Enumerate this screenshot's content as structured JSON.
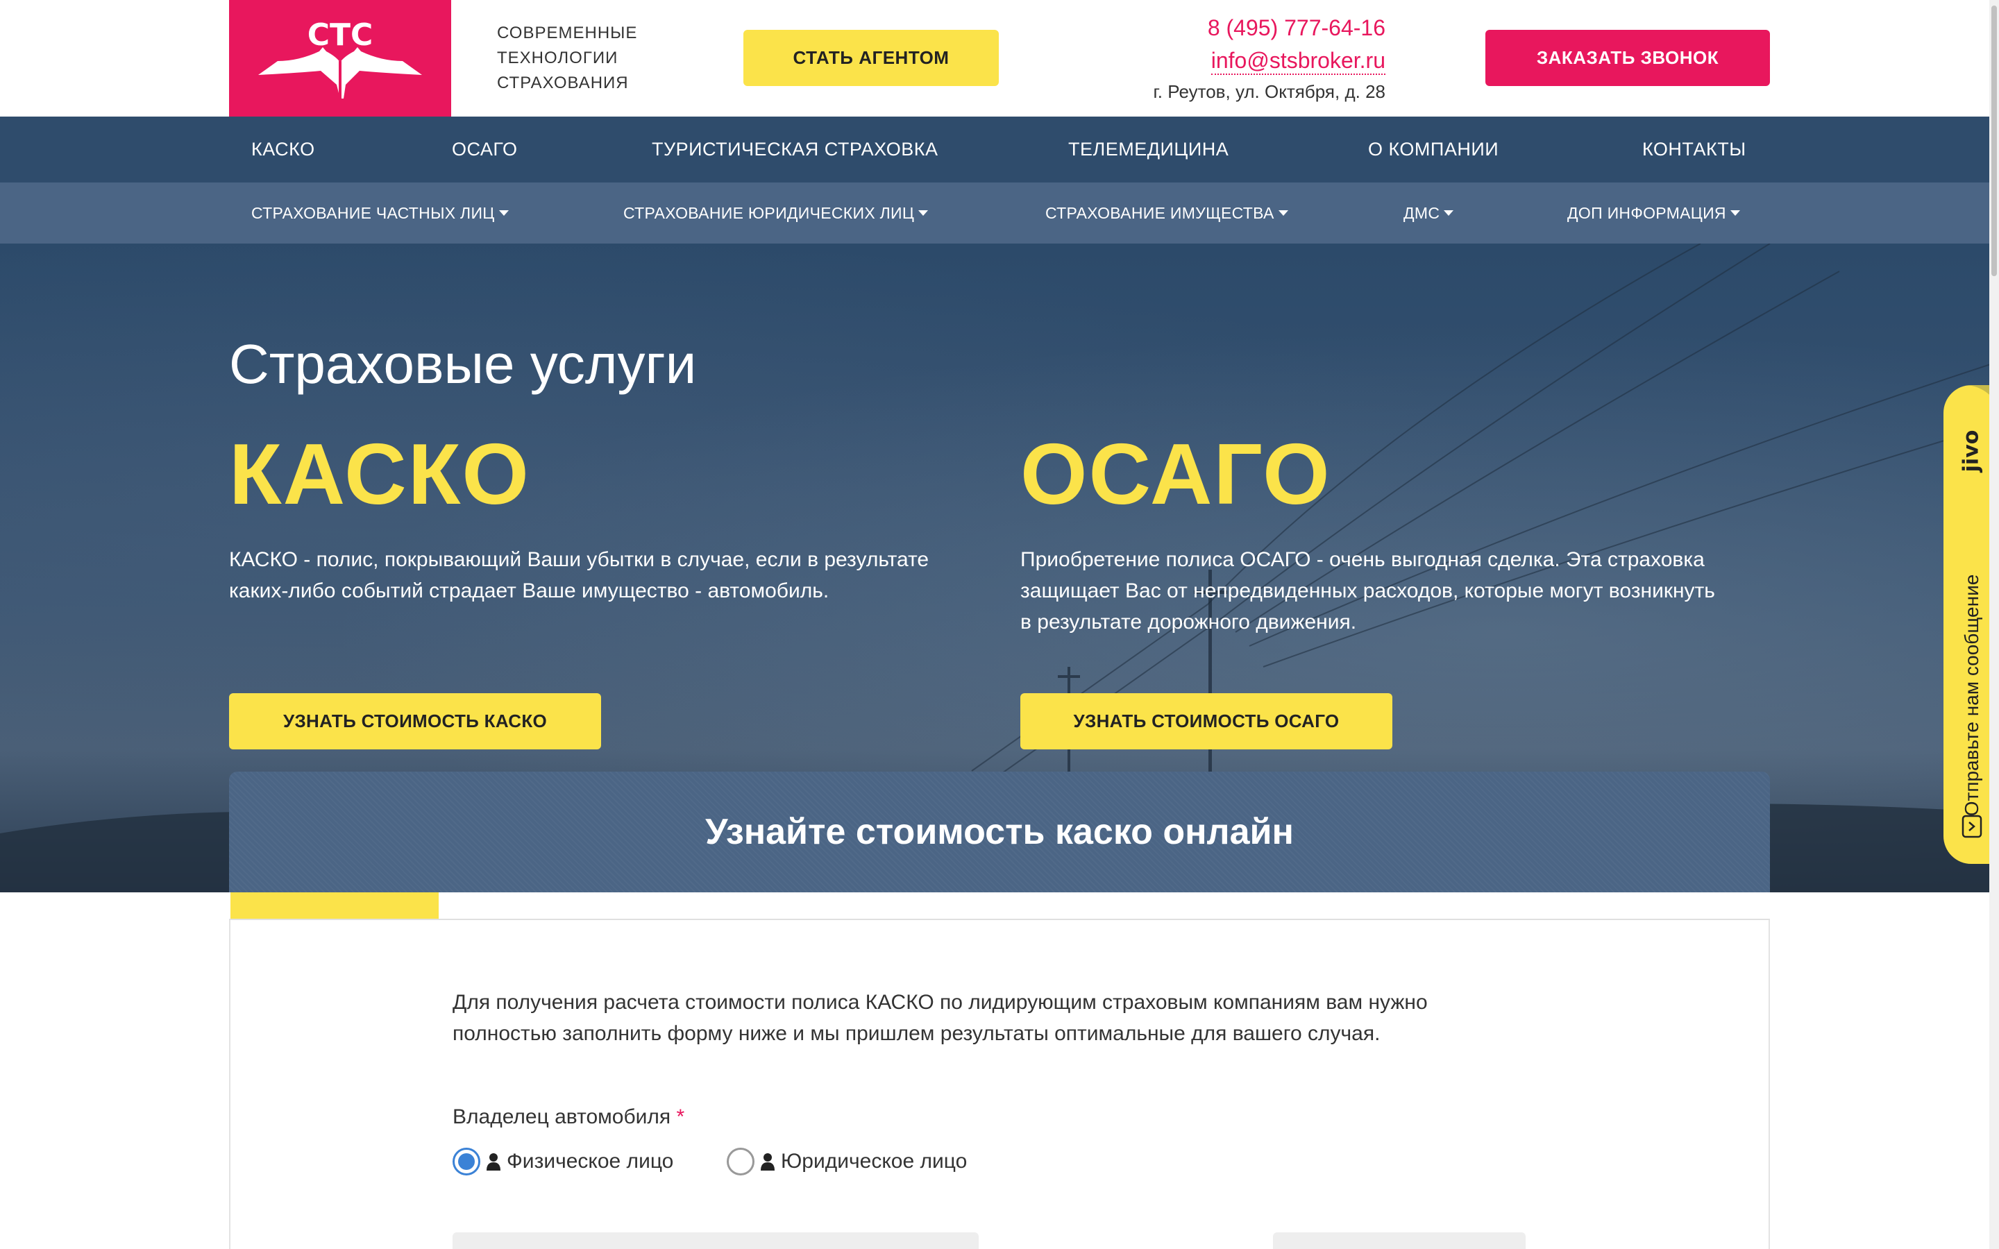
{
  "header": {
    "logo_text": "СТС",
    "tagline_lines": [
      "Современные",
      "технологии",
      "страхования"
    ],
    "agent_button": "СТАТЬ АГЕНТОМ",
    "phone": "8 (495) 777-64-16",
    "email": "info@stsbroker.ru",
    "address": "г. Реутов, ул. Октября, д. 28",
    "callback_button": "ЗАКАЗАТЬ ЗВОНОК"
  },
  "nav_main": [
    {
      "label": "КАСКО"
    },
    {
      "label": "ОСАГО"
    },
    {
      "label": "ТУРИСТИЧЕСКАЯ СТРАХОВКА"
    },
    {
      "label": "ТЕЛЕМЕДИЦИНА"
    },
    {
      "label": "О КОМПАНИИ"
    },
    {
      "label": "КОНТАКТЫ"
    }
  ],
  "nav_sub": [
    {
      "label": "СТРАХОВАНИЕ ЧАСТНЫХ ЛИЦ"
    },
    {
      "label": "СТРАХОВАНИЕ ЮРИДИЧЕСКИХ ЛИЦ"
    },
    {
      "label": "СТРАХОВАНИЕ ИМУЩЕСТВА"
    },
    {
      "label": "ДМС"
    },
    {
      "label": "ДОП ИНФОРМАЦИЯ"
    }
  ],
  "hero": {
    "title": "Страховые услуги",
    "kasko": {
      "heading": "КАСКО",
      "description": "КАСКО - полис, покрывающий Ваши убытки в случае, если в результате каких-либо событий страдает Ваше имущество - автомобиль.",
      "button": "УЗНАТЬ СТОИМОСТЬ КАСКО"
    },
    "osago": {
      "heading": "ОСАГО",
      "description": "Приобретение полиса ОСАГО - очень выгодная сделка. Эта страховка защищает Вас от непредвиденных расходов, которые могут возникнуть в результате дорожного движения.",
      "button": "УЗНАТЬ СТОИМОСТЬ ОСАГО"
    }
  },
  "calc": {
    "title": "Узнайте стоимость каско онлайн",
    "intro": "Для получения расчета стоимости полиса КАСКО по лидирующим страховым компаниям вам нужно полностью заполнить форму ниже и мы пришлем результаты оптимальные для вашего случая.",
    "owner_label": "Владелец автомобиля",
    "required_mark": "*",
    "owner_options": [
      {
        "label": "Физическое лицо",
        "selected": true
      },
      {
        "label": "Юридическое лицо",
        "selected": false
      }
    ]
  },
  "jivo": {
    "brand": "jivo",
    "label": "Отправьте нам сообщение"
  },
  "colors": {
    "brand_pink": "#e8175d",
    "accent_yellow": "#fbe34a",
    "nav_dark": "#2f4c6c",
    "nav_light": "#4b6585"
  }
}
